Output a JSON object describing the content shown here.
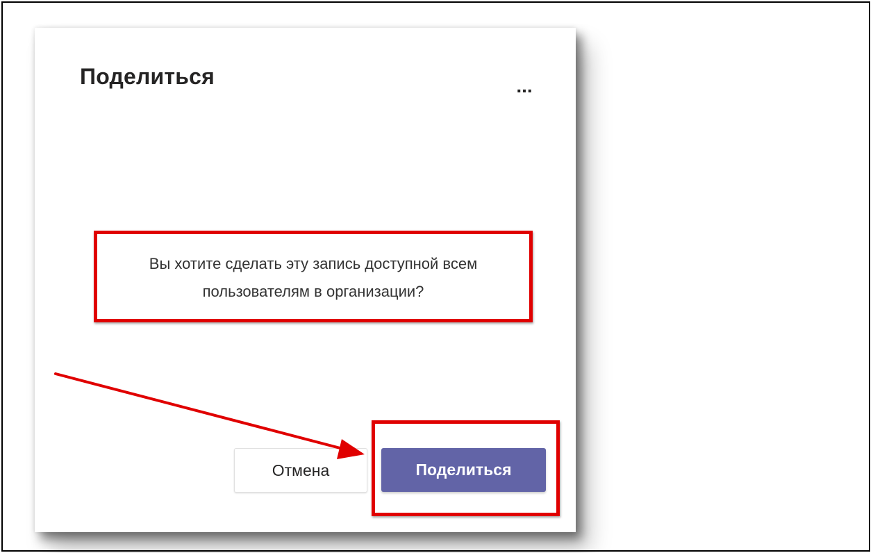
{
  "dialog": {
    "title": "Поделиться",
    "more_label": "...",
    "message_lines": [
      "Вы хотите сделать эту запись доступной всем",
      "пользователям в организации?"
    ],
    "cancel_label": "Отмена",
    "share_label": "Поделиться"
  },
  "colors": {
    "accent": "#6264a7",
    "annotation": "#e00000",
    "text": "#252424"
  },
  "icons": {
    "more": "more-options-icon",
    "annotation_arrow": "arrow-annotation"
  }
}
